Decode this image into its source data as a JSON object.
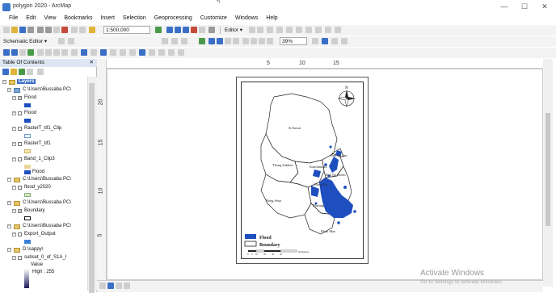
{
  "window": {
    "title": "polygon 2020 - ArcMap",
    "controls": [
      "—",
      "☐",
      "✕"
    ],
    "marker": "ฯ"
  },
  "menu": [
    "File",
    "Edit",
    "View",
    "Bookmarks",
    "Insert",
    "Selection",
    "Geoprocessing",
    "Customize",
    "Windows",
    "Help"
  ],
  "toolbar": {
    "scale": "1:500,000",
    "editor_label": "Editor ▾",
    "schematic_label": "Schematic Editor ▾",
    "zoom_percent": "39%"
  },
  "toc": {
    "title": "Table Of Contents",
    "close": "✕",
    "root": "Layers",
    "items": [
      {
        "label": "C:\\Users\\Bussaba PC\\",
        "kind": "folder"
      },
      {
        "label": "Flood",
        "kind": "layer",
        "checked": true
      },
      {
        "label": "Flood",
        "kind": "layer",
        "checked": false
      },
      {
        "label": "RasterT_tif1_Clip",
        "kind": "layer",
        "checked": false
      },
      {
        "label": "RasterT_tif1",
        "kind": "layer",
        "checked": false
      },
      {
        "label": "Band_1_Clip3",
        "kind": "layer",
        "checked": false
      },
      {
        "label": "Flood",
        "kind": "legend"
      },
      {
        "label": "C:\\Users\\Bussaba PC\\",
        "kind": "folder"
      },
      {
        "label": "flood_y2020",
        "kind": "layer",
        "checked": false
      },
      {
        "label": "C:\\Users\\Bussaba PC\\",
        "kind": "folder"
      },
      {
        "label": "Boundary",
        "kind": "layer",
        "checked": true
      },
      {
        "label": "C:\\Users\\Bussaba PC\\",
        "kind": "folder"
      },
      {
        "label": "Export_Output",
        "kind": "layer",
        "checked": false
      },
      {
        "label": "D:\\sappy\\",
        "kind": "folder"
      },
      {
        "label": "subset_0_of_S1A_I",
        "kind": "layer",
        "checked": false
      },
      {
        "label": "Value",
        "kind": "legend"
      },
      {
        "label": "High : 255",
        "kind": "legend"
      }
    ]
  },
  "ruler": {
    "top": [
      "5",
      "10",
      "15"
    ],
    "left": [
      "20",
      "15",
      "10",
      "5"
    ]
  },
  "map": {
    "districts": [
      {
        "name": "Si Sawat"
      },
      {
        "name": "Thong Sukhon"
      },
      {
        "name": "Kanchanadit"
      },
      {
        "name": "Ban Na San"
      },
      {
        "name": "Nong Yai"
      },
      {
        "name": "Nong Seua"
      },
      {
        "name": "Mueang"
      },
      {
        "name": "Khao Mao"
      },
      {
        "name": "Ban Na Doem"
      }
    ],
    "legend": {
      "flood": "Flood",
      "boundary": "Boundary"
    },
    "scalebar": [
      "0",
      "5",
      "10",
      "20",
      "30",
      "40",
      "Kilometers"
    ],
    "north": "N",
    "colors": {
      "flood": "#1f4fbf",
      "boundary": "#222222"
    }
  },
  "watermark": {
    "line1": "Activate Windows",
    "line2": "Go to Settings to activate Windows."
  }
}
